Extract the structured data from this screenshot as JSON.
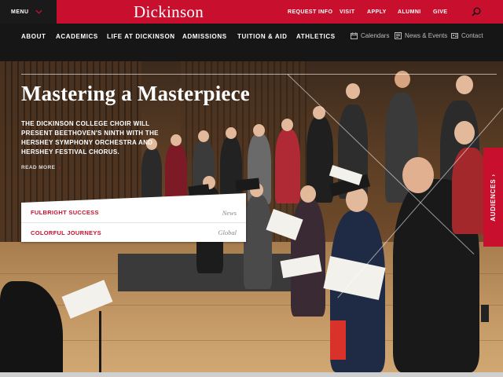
{
  "topbar": {
    "menu_label": "MENU",
    "logo": "Dickinson",
    "utility_links": [
      "REQUEST INFO",
      "VISIT",
      "APPLY",
      "ALUMNI",
      "GIVE"
    ]
  },
  "nav": {
    "items": [
      "ABOUT",
      "ACADEMICS",
      "LIFE AT DICKINSON",
      "ADMISSIONS",
      "TUITION & AID",
      "ATHLETICS"
    ],
    "utility": [
      {
        "label": "Calendars",
        "icon": "calendar-icon"
      },
      {
        "label": "News & Events",
        "icon": "newspaper-icon"
      },
      {
        "label": "Contact",
        "icon": "contact-card-icon"
      }
    ]
  },
  "hero": {
    "title": "Mastering a Masterpiece",
    "description": "THE DICKINSON COLLEGE CHOIR WILL PRESENT BEETHOVEN'S NINTH WITH THE HERSHEY SYMPHONY ORCHESTRA AND HERSHEY FESTIVAL CHORUS.",
    "read_more": "READ MORE",
    "image_icon": "choir-photo"
  },
  "promo": [
    {
      "label": "FULBRIGHT SUCCESS",
      "category": "News"
    },
    {
      "label": "COLORFUL JOURNEYS",
      "category": "Global"
    }
  ],
  "audiences": "AUDIENCES",
  "colors": {
    "brand_red": "#c8102e",
    "nav_dark": "#161616"
  }
}
